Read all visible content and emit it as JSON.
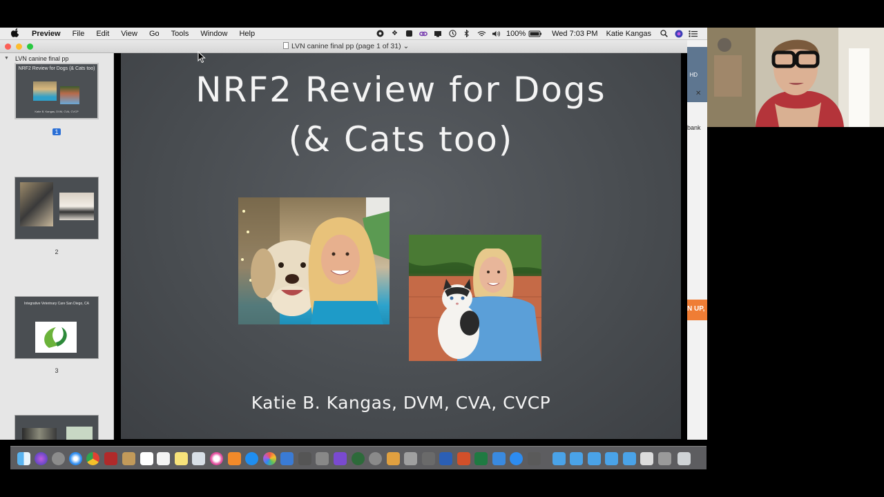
{
  "menubar": {
    "app_name": "Preview",
    "menus": [
      "File",
      "Edit",
      "View",
      "Go",
      "Tools",
      "Window",
      "Help"
    ],
    "battery": "100%",
    "clock": "Wed 7:03 PM",
    "user": "Katie Kangas"
  },
  "window": {
    "title": "LVN canine final pp (page 1 of 31)"
  },
  "sidebar": {
    "title": "LVN canine final pp",
    "thumbs": [
      {
        "number": "1",
        "text": "NRF2 Review for Dogs (& Cats too)",
        "author": "Katie B. Kangas, DVM, CVA, CVCP"
      },
      {
        "number": "2"
      },
      {
        "number": "3",
        "text": "Integrative Veterinary Care San Diego, CA"
      }
    ]
  },
  "slide": {
    "title_line1": "NRF2 Review for Dogs",
    "title_line2": "(& Cats too)",
    "author": "Katie B. Kangas, DVM, CVA, CVCP"
  },
  "background_window": {
    "fragment_hd": "HD",
    "fragment_bank": "bank",
    "fragment_signup": "N UP,"
  },
  "colors": {
    "slide_bg": "#4b4f53",
    "selection": "#2a6fd6",
    "close": "#fc5f57",
    "minimize": "#fdbc2e",
    "zoom": "#28c840"
  }
}
